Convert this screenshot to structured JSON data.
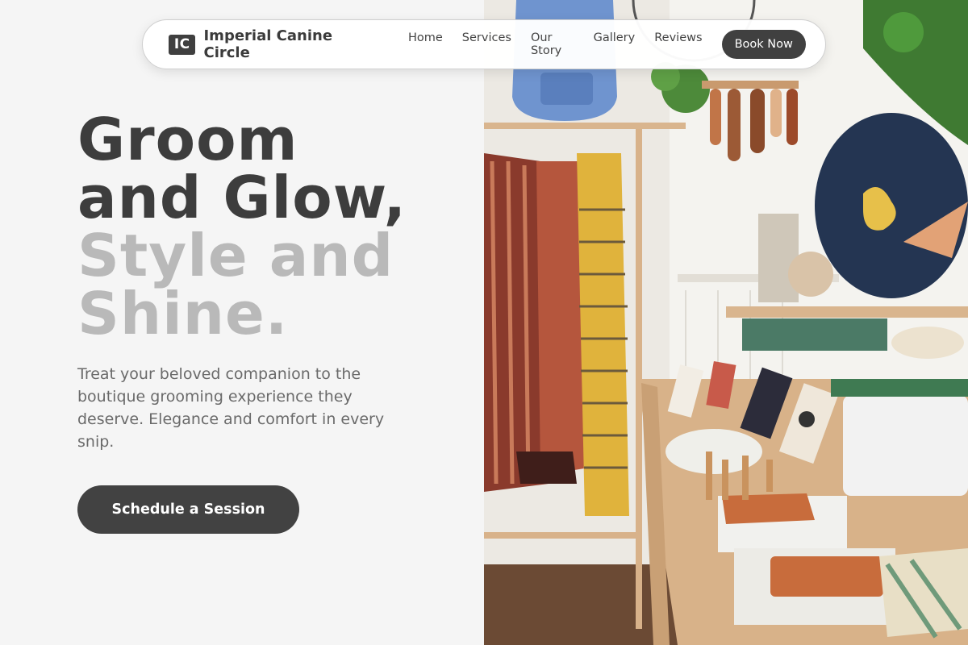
{
  "nav": {
    "logo_mark": "IC",
    "brand": "Imperial Canine Circle",
    "links": [
      "Home",
      "Services",
      "Our Story",
      "Gallery",
      "Reviews"
    ],
    "book_label": "Book Now"
  },
  "hero": {
    "headline_line1": "Groom",
    "headline_line2": "and Glow,",
    "headline_line3": "Style and",
    "headline_line4": "Shine.",
    "subtitle": "Treat your beloved companion to the boutique grooming experience they deserve. Elegance and comfort in every snip.",
    "cta_label": "Schedule a Session"
  },
  "colors": {
    "background": "#f5f5f5",
    "dark": "#3d3d3d",
    "muted_heading": "#b9b9b9",
    "button": "#424242"
  },
  "image": {
    "icon": "boutique-photo"
  }
}
